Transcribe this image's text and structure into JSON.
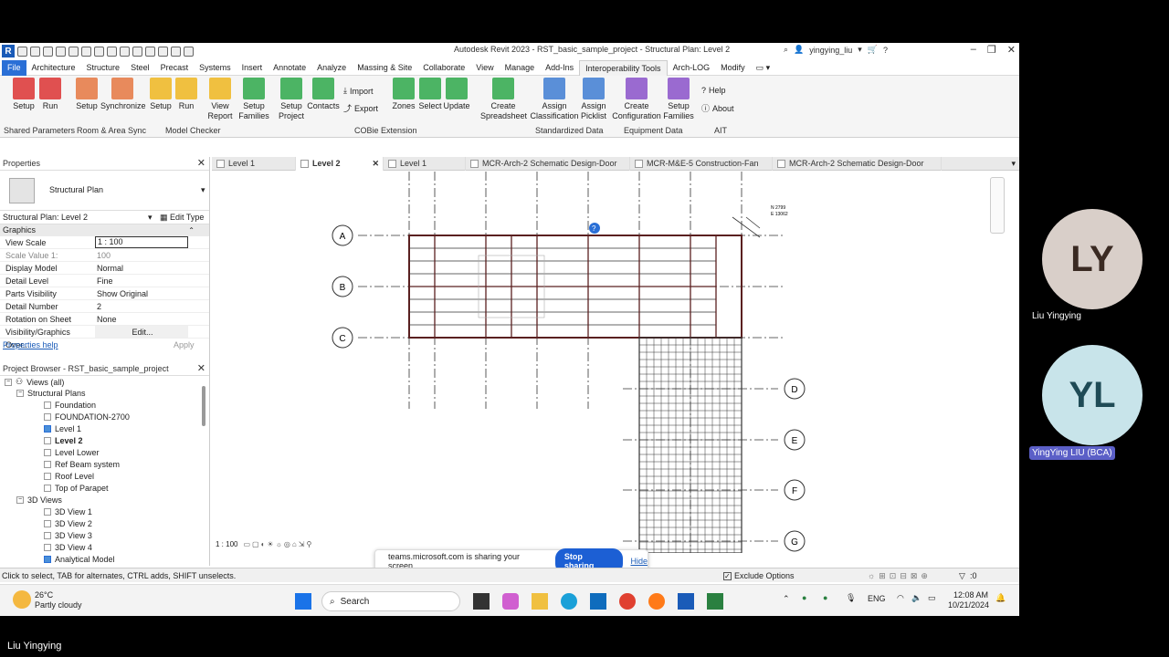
{
  "app": {
    "title": "Autodesk Revit 2023 - RST_basic_sample_project - Structural Plan: Level 2",
    "user": "yingying_liu"
  },
  "menu_tabs": [
    "File",
    "Architecture",
    "Structure",
    "Steel",
    "Precast",
    "Systems",
    "Insert",
    "Annotate",
    "Analyze",
    "Massing & Site",
    "Collaborate",
    "View",
    "Manage",
    "Add-Ins",
    "Interoperability Tools",
    "Arch-LOG",
    "Modify"
  ],
  "ribbon": {
    "tools": {
      "setup1": "Setup",
      "run1": "Run",
      "setup2": "Setup",
      "synchronize": "Synchronize",
      "setup3": "Setup",
      "run2": "Run",
      "view_report": "View Report",
      "setup_families": "Setup Families",
      "setup_project": "Setup Project",
      "contacts": "Contacts",
      "import": "Import",
      "export": "Export",
      "zones": "Zones",
      "select": "Select",
      "update": "Update",
      "create_spreadsheet": "Create Spreadsheet",
      "assign_classification": "Assign Classification",
      "assign_picklist": "Assign Picklist",
      "create_configuration": "Create Configuration",
      "setup_families2": "Setup Families",
      "help": "Help",
      "about": "About"
    },
    "groups": {
      "shared_parameters": "Shared Parameters",
      "room_area_sync": "Room & Area Sync",
      "model_checker": "Model Checker",
      "cobie": "COBie Extension",
      "standardized_data": "Standardized Data",
      "equipment_data": "Equipment Data",
      "ait": "AIT"
    }
  },
  "view_tabs": [
    "Level 1",
    "Level 2",
    "Level 1",
    "MCR-Arch-2 Schematic Design-Door",
    "MCR-M&E-5 Construction-Fan",
    "MCR-Arch-2 Schematic Design-Door"
  ],
  "properties": {
    "title": "Properties",
    "type": "Structural Plan",
    "selector": "Structural Plan: Level 2",
    "edit_type": "Edit Type",
    "section": "Graphics",
    "rows": [
      {
        "k": "View Scale",
        "v": "1 : 100"
      },
      {
        "k": "Scale Value    1:",
        "v": "100"
      },
      {
        "k": "Display Model",
        "v": "Normal"
      },
      {
        "k": "Detail Level",
        "v": "Fine"
      },
      {
        "k": "Parts Visibility",
        "v": "Show Original"
      },
      {
        "k": "Detail Number",
        "v": "2"
      },
      {
        "k": "Rotation on Sheet",
        "v": "None"
      },
      {
        "k": "Visibility/Graphics Over...",
        "v": "Edit..."
      }
    ],
    "help": "Properties help",
    "apply": "Apply"
  },
  "browser": {
    "title": "Project Browser - RST_basic_sample_project",
    "root": "Views (all)",
    "structural_plans": "Structural Plans",
    "plans": [
      "Foundation",
      "FOUNDATION-2700",
      "Level 1",
      "Level 2",
      "Level Lower",
      "Ref Beam system",
      "Roof Level",
      "Top of Parapet"
    ],
    "views_3d": "3D Views",
    "views3d": [
      "3D View 1",
      "3D View 2",
      "3D View 3",
      "3D View 4",
      "Analytical Model"
    ]
  },
  "canvas": {
    "grids_left": [
      "A",
      "B",
      "C"
    ],
    "grids_right": [
      "D",
      "E",
      "F",
      "G"
    ],
    "coord_n": "N 2799",
    "coord_e": "E 13062",
    "scale": "1 : 100"
  },
  "status": {
    "hint": "Click to select, TAB for alternates, CTRL adds, SHIFT unselects.",
    "exclude": "Exclude Options",
    "filter_count": ":0"
  },
  "share": {
    "text": "teams.microsoft.com is sharing your screen.",
    "stop": "Stop sharing",
    "hide": "Hide"
  },
  "taskbar": {
    "temp": "26°C",
    "weather": "Partly cloudy",
    "search": "Search",
    "lang": "ENG",
    "time": "12:08 AM",
    "date": "10/21/2024"
  },
  "participants": [
    {
      "initials": "LY",
      "name": "Liu Yingying",
      "color": "#d9cfc9",
      "text": "#3a2a22"
    },
    {
      "initials": "YL",
      "name": "YingYing LIU (BCA)",
      "color": "#c8e4ea",
      "text": "#1f4b56"
    }
  ],
  "presenter": "Liu Yingying"
}
